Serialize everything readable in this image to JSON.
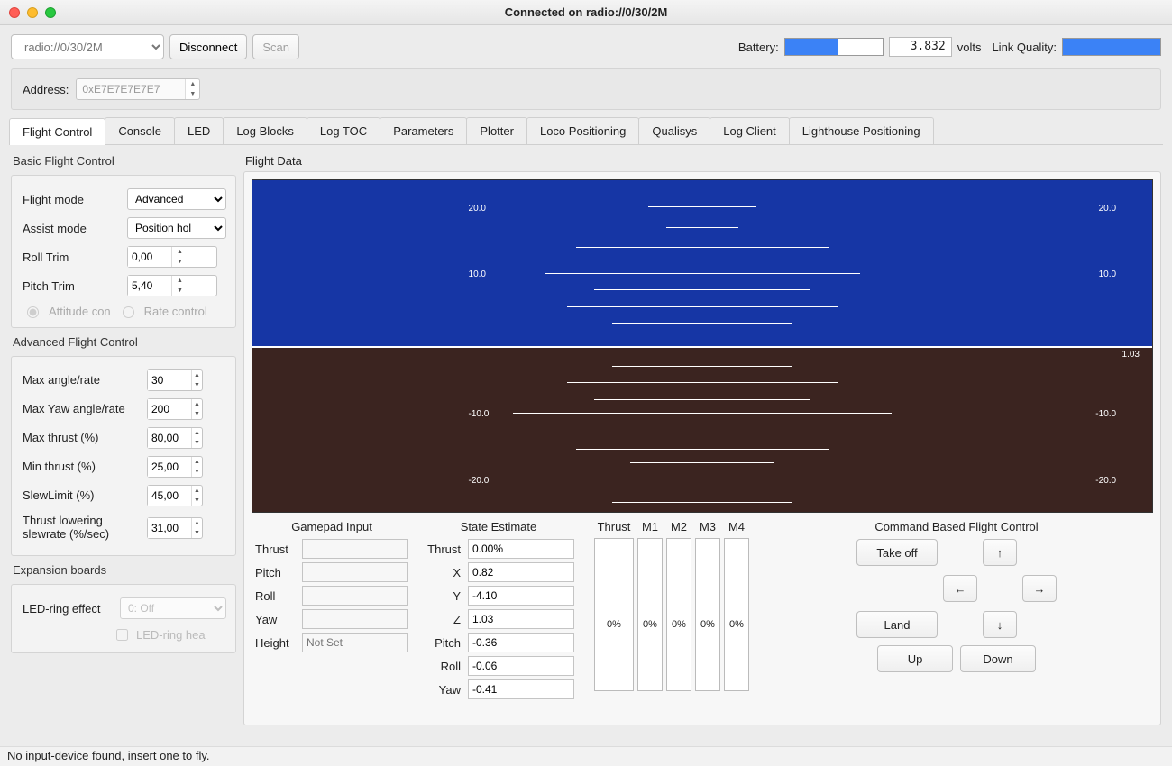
{
  "window": {
    "title": "Connected on radio://0/30/2M"
  },
  "toolbar": {
    "uri": "radio://0/30/2M",
    "disconnect": "Disconnect",
    "scan": "Scan",
    "battery_label": "Battery:",
    "battery_fill_pct": 55,
    "voltage": "3.832",
    "volts_label": "volts",
    "link_label": "Link Quality:"
  },
  "address": {
    "label": "Address:",
    "value": "0xE7E7E7E7E7"
  },
  "tabs": [
    "Flight Control",
    "Console",
    "LED",
    "Log Blocks",
    "Log TOC",
    "Parameters",
    "Plotter",
    "Loco Positioning",
    "Qualisys",
    "Log Client",
    "Lighthouse Positioning"
  ],
  "basic": {
    "heading": "Basic Flight Control",
    "flight_mode_label": "Flight mode",
    "flight_mode": "Advanced",
    "assist_mode_label": "Assist mode",
    "assist_mode": "Position hol",
    "roll_trim_label": "Roll Trim",
    "roll_trim": "0,00",
    "pitch_trim_label": "Pitch Trim",
    "pitch_trim": "5,40",
    "radio_attitude": "Attitude con",
    "radio_rate": "Rate control"
  },
  "advanced": {
    "heading": "Advanced Flight Control",
    "max_angle_label": "Max angle/rate",
    "max_angle": "30",
    "max_yaw_label": "Max Yaw angle/rate",
    "max_yaw": "200",
    "max_thrust_label": "Max thrust (%)",
    "max_thrust": "80,00",
    "min_thrust_label": "Min thrust (%)",
    "min_thrust": "25,00",
    "slew_limit_label": "SlewLimit (%)",
    "slew_limit": "45,00",
    "thrust_lower_label": "Thrust lowering slewrate (%/sec)",
    "thrust_lower": "31,00"
  },
  "expansion": {
    "heading": "Expansion boards",
    "led_label": "LED-ring effect",
    "led_value": "0: Off",
    "led_head": "LED-ring hea"
  },
  "flight_data": {
    "heading": "Flight Data",
    "alt_readout": "1.03"
  },
  "gamepad": {
    "title": "Gamepad Input",
    "thrust": "Thrust",
    "pitch": "Pitch",
    "roll": "Roll",
    "yaw": "Yaw",
    "height": "Height",
    "height_ph": "Not Set"
  },
  "state": {
    "title": "State Estimate",
    "rows": {
      "thrust_label": "Thrust",
      "thrust": "0.00%",
      "x_label": "X",
      "x": "0.82",
      "y_label": "Y",
      "y": "-4.10",
      "z_label": "Z",
      "z": "1.03",
      "pitch_label": "Pitch",
      "pitch": "-0.36",
      "roll_label": "Roll",
      "roll": "-0.06",
      "yaw_label": "Yaw",
      "yaw": "-0.41"
    }
  },
  "motors": {
    "titles": [
      "Thrust",
      "M1",
      "M2",
      "M3",
      "M4"
    ],
    "values": [
      "0%",
      "0%",
      "0%",
      "0%",
      "0%"
    ]
  },
  "command": {
    "title": "Command Based Flight Control",
    "takeoff": "Take off",
    "land": "Land",
    "up": "Up",
    "down": "Down",
    "arrow_up": "↑",
    "arrow_down": "↓",
    "arrow_left": "←",
    "arrow_right": "→"
  },
  "status": "No input-device found, insert one to fly.",
  "chart_data": {
    "type": "scale",
    "note": "Artificial horizon pitch ladder ticks",
    "ticks": [
      20,
      10,
      0,
      -10,
      -20
    ],
    "left_labels": [
      "20.0",
      "10.0",
      "-10.0",
      "-20.0"
    ],
    "right_labels": [
      "20.0",
      "10.0",
      "-10.0",
      "-20.0"
    ]
  }
}
